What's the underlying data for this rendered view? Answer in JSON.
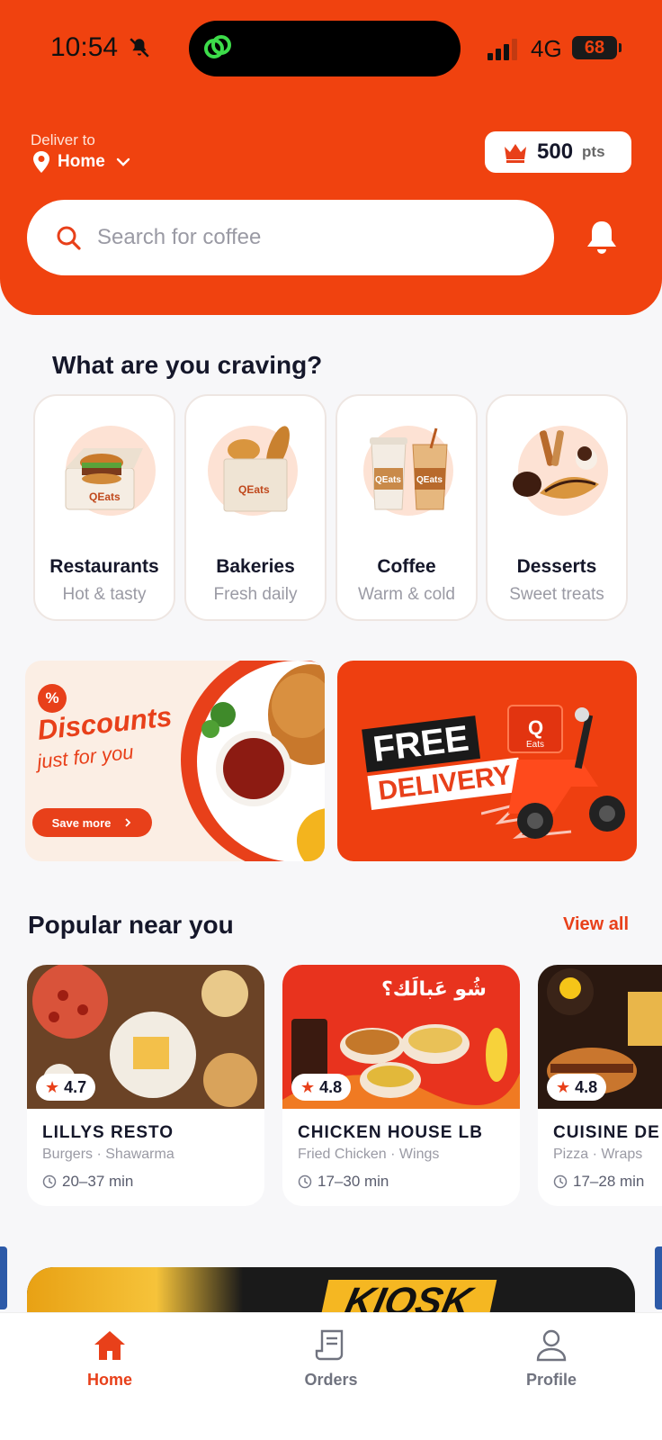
{
  "status_bar": {
    "time": "10:54",
    "network": "4G",
    "battery": "68"
  },
  "header": {
    "deliver_label": "Deliver to",
    "location": "Home",
    "points_value": "500",
    "points_unit": "pts",
    "search_placeholder": "Search for coffee",
    "icons": [
      "location-pin-icon",
      "chevron-down-icon",
      "crown-icon",
      "search-icon",
      "bell-icon"
    ]
  },
  "craving": {
    "title": "What are you craving?",
    "categories": [
      {
        "name": "Restaurants",
        "subtitle": "Hot & tasty",
        "bag_text": "QEats"
      },
      {
        "name": "Bakeries",
        "subtitle": "Fresh daily",
        "bag_text": "QEats"
      },
      {
        "name": "Coffee",
        "subtitle": "Warm & cold",
        "bag_text": "QEats"
      },
      {
        "name": "Desserts",
        "subtitle": "Sweet treats"
      }
    ]
  },
  "banners": {
    "discount": {
      "badge": "%",
      "title": "Discounts",
      "subtitle": "just for you",
      "button": "Save more",
      "button_icon": "chevron-right-icon"
    },
    "delivery": {
      "line1": "FREE",
      "line2": "DELIVERY",
      "box_letter": "Q",
      "box_text": "Eats"
    }
  },
  "popular": {
    "title": "Popular near you",
    "view_all": "View all",
    "restaurants": [
      {
        "name": "LILLYS RESTO",
        "tags": "Burgers · Shawarma",
        "eta": "20–37 min",
        "rating": "4.7"
      },
      {
        "name": "CHICKEN HOUSE LB",
        "tags": "Fried Chicken · Wings",
        "eta": "17–30 min",
        "rating": "4.8",
        "photo_text": "شُو عَبالَك؟"
      },
      {
        "name": "CUISINE DE",
        "tags": "Pizza · Wraps",
        "eta": "17–28 min",
        "rating": "4.8"
      }
    ]
  },
  "promo_peek": {
    "text": "KIOSK"
  },
  "tabbar": {
    "items": [
      {
        "label": "Home",
        "icon": "home-icon",
        "active": true
      },
      {
        "label": "Orders",
        "icon": "receipt-icon",
        "active": false
      },
      {
        "label": "Profile",
        "icon": "user-icon",
        "active": false
      }
    ]
  },
  "colors": {
    "brand": "#f0420f",
    "accent": "#e8401a",
    "text": "#15172a",
    "muted": "#9a9aa4"
  }
}
